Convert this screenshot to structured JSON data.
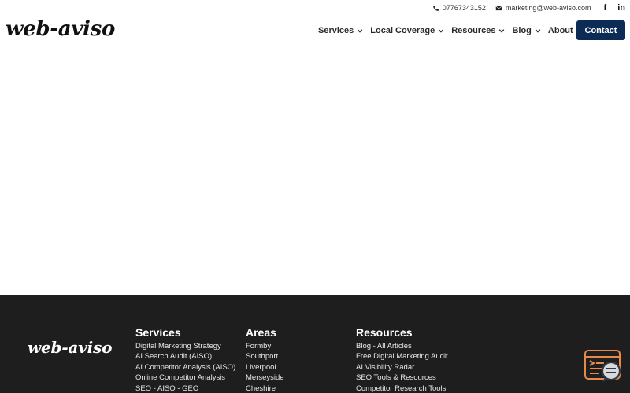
{
  "topbar": {
    "phone": "07767343152",
    "email": "marketing@web-aviso.com",
    "social": {
      "facebook": "f",
      "linkedin": "in"
    }
  },
  "header": {
    "logo": "web-aviso",
    "nav": [
      {
        "label": "Services"
      },
      {
        "label": "Local Coverage"
      },
      {
        "label": "Resources"
      },
      {
        "label": "Blog"
      },
      {
        "label": "About"
      }
    ],
    "contact_label": "Contact"
  },
  "footer": {
    "logo": "web-aviso",
    "services": {
      "heading": "Services",
      "items": [
        "Digital Marketing Strategy",
        "AI Search Audit (AISO)",
        "AI Competitor Analysis (AISO)",
        "Online Competitor Analysis",
        "SEO - AISO - GEO"
      ]
    },
    "areas": {
      "heading": "Areas",
      "items": [
        "Formby",
        "Southport",
        "Liverpool",
        "Merseyside",
        "Cheshire"
      ]
    },
    "resources": {
      "heading": "Resources",
      "items": [
        "Blog - All Articles",
        "Free Digital Marketing Audit",
        "AI Visibility Radar",
        "SEO Tools & Resources",
        "Competitor Research Tools"
      ]
    }
  },
  "colors": {
    "brand_navy": "#0c2c56",
    "footer_bg": "#1e1e1f",
    "widget_orange": "#e8894a"
  }
}
